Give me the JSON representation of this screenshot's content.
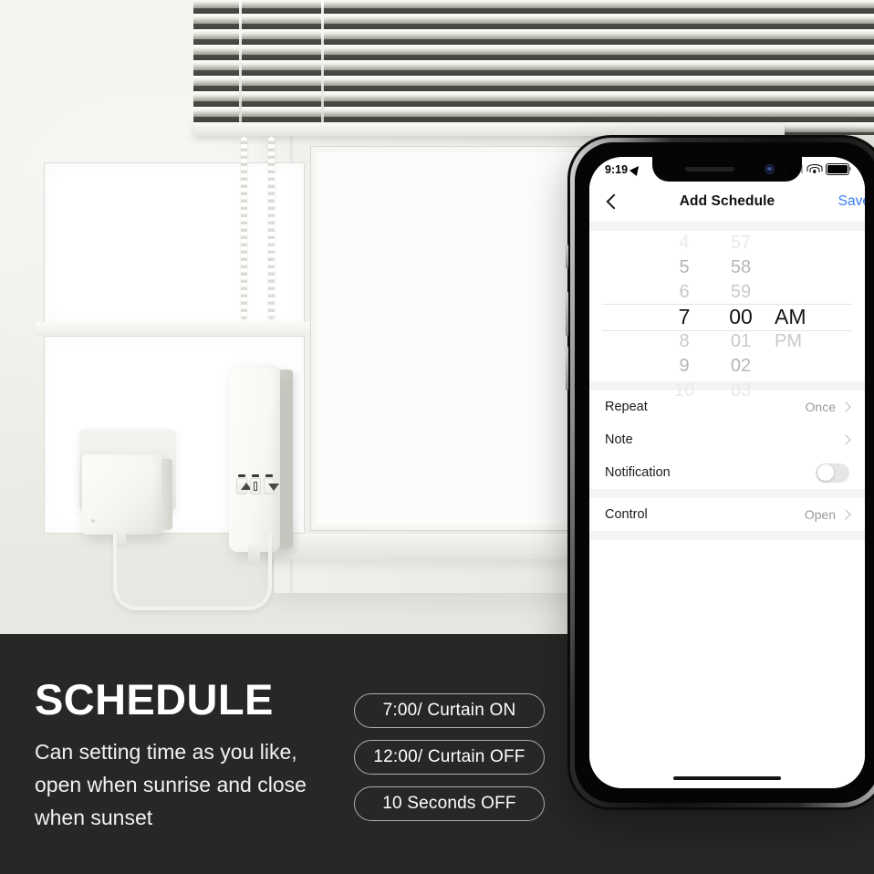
{
  "phone": {
    "status_bar": {
      "time": "9:19",
      "location_icon": "location-arrow-icon",
      "signal_icon": "cellular-signal-icon",
      "wifi_icon": "wifi-icon",
      "battery_icon": "battery-icon"
    },
    "nav": {
      "back_icon": "chevron-left-icon",
      "title": "Add Schedule",
      "save_label": "Save",
      "save_color": "#3A7BF0"
    },
    "time_picker": {
      "hours": [
        "4",
        "5",
        "6",
        "7",
        "8",
        "9",
        "10"
      ],
      "minutes": [
        "57",
        "58",
        "59",
        "00",
        "01",
        "02",
        "03"
      ],
      "meridiem": [
        "",
        "",
        "",
        "AM",
        "PM",
        "",
        ""
      ],
      "selected_hour": "7",
      "selected_minute": "00",
      "selected_meridiem": "AM"
    },
    "settings": [
      {
        "label": "Repeat",
        "value": "Once",
        "accessory": "chevron-right-icon"
      },
      {
        "label": "Note",
        "value": "",
        "accessory": "chevron-right-icon"
      },
      {
        "label": "Notification",
        "value": "",
        "accessory": "toggle-off"
      }
    ],
    "control_section": [
      {
        "label": "Control",
        "value": "Open",
        "accessory": "chevron-right-icon"
      }
    ]
  },
  "panel": {
    "background_color": "#272726",
    "headline": "SCHEDULE",
    "subcopy": "Can setting time as you like, open when sunrise and close when sunset",
    "pills": [
      "7:00/ Curtain ON",
      "12:00/ Curtain OFF",
      "10 Seconds OFF"
    ]
  },
  "scene": {
    "wall_color": "#EDEDE8",
    "blinds": "venetian-blinds",
    "devices": [
      "power-adapter-cube",
      "curtain-motor-module"
    ]
  }
}
